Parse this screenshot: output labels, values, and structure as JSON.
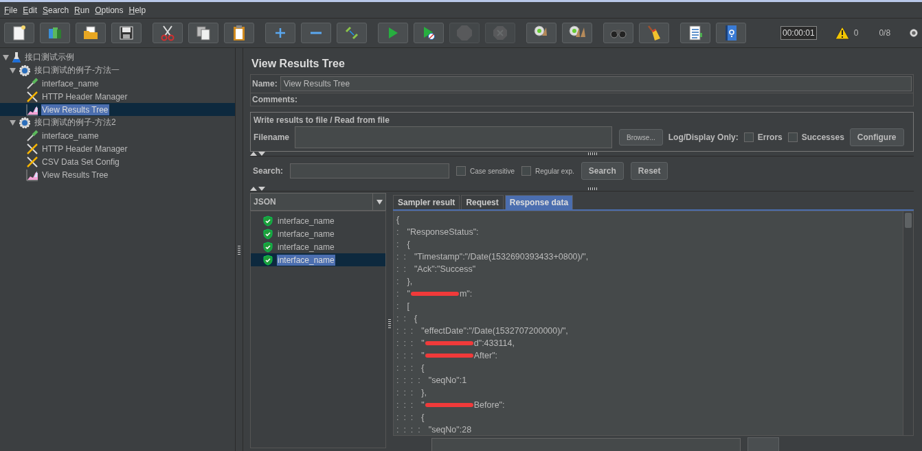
{
  "menu": [
    {
      "label": "File"
    },
    {
      "label": "Edit"
    },
    {
      "label": "Search"
    },
    {
      "label": "Run"
    },
    {
      "label": "Options"
    },
    {
      "label": "Help"
    }
  ],
  "toolbar": {
    "groups": [
      {
        "buttons": [
          {
            "kind": "new",
            "disabled": false
          },
          {
            "kind": "templates",
            "disabled": false
          },
          {
            "kind": "open",
            "disabled": false
          },
          {
            "kind": "save",
            "disabled": false
          }
        ]
      },
      {
        "buttons": [
          {
            "kind": "cut",
            "disabled": false
          },
          {
            "kind": "copy",
            "disabled": false
          },
          {
            "kind": "paste",
            "disabled": false
          }
        ]
      },
      {
        "buttons": [
          {
            "kind": "add",
            "disabled": false
          },
          {
            "kind": "remove",
            "disabled": false
          },
          {
            "kind": "toggle",
            "disabled": false
          }
        ]
      },
      {
        "buttons": [
          {
            "kind": "start",
            "disabled": false
          },
          {
            "kind": "start_no_timers",
            "disabled": false
          },
          {
            "kind": "stop",
            "disabled": true
          },
          {
            "kind": "shutdown",
            "disabled": true
          }
        ]
      },
      {
        "buttons": [
          {
            "kind": "clear",
            "disabled": false
          },
          {
            "kind": "clear_all",
            "disabled": false
          }
        ]
      },
      {
        "buttons": [
          {
            "kind": "search",
            "disabled": false
          },
          {
            "kind": "reset",
            "disabled": false
          }
        ]
      },
      {
        "buttons": [
          {
            "kind": "function_helper",
            "disabled": false
          },
          {
            "kind": "help",
            "disabled": false
          }
        ]
      }
    ],
    "timer": "00:00:01",
    "warnings": "0",
    "threads": "0/8"
  },
  "tree": [
    {
      "label": "接口测试示例",
      "kind": "testplan",
      "expanded": true,
      "selected": false,
      "children": [
        {
          "label": "接口测试的例子-方法一",
          "kind": "threadgroup",
          "expanded": true,
          "selected": false,
          "children": [
            {
              "label": "interface_name",
              "kind": "sampler",
              "selected": false
            },
            {
              "label": "HTTP Header Manager",
              "kind": "config",
              "selected": false
            },
            {
              "label": "View Results Tree",
              "kind": "listener",
              "selected": true
            }
          ]
        },
        {
          "label": "接口测试的例子-方法2",
          "kind": "threadgroup",
          "expanded": true,
          "selected": false,
          "children": [
            {
              "label": "interface_name",
              "kind": "sampler",
              "selected": false
            },
            {
              "label": "HTTP Header Manager",
              "kind": "config",
              "selected": false
            },
            {
              "label": "CSV Data Set Config",
              "kind": "config",
              "selected": false
            },
            {
              "label": "View Results Tree",
              "kind": "listener",
              "selected": false
            }
          ]
        }
      ]
    }
  ],
  "panel": {
    "title": "View Results Tree",
    "name_label": "Name:",
    "name_value": "View Results Tree",
    "comments_label": "Comments:",
    "file_group": {
      "legend": "Write results to file / Read from file",
      "filename_label": "Filename",
      "browse": "Browse...",
      "log_label": "Log/Display Only:",
      "errors": {
        "label": "Errors",
        "checked": false
      },
      "successes": {
        "label": "Successes",
        "checked": false
      },
      "configure": "Configure"
    },
    "search": {
      "label": "Search:",
      "case_sensitive": {
        "label": "Case sensitive",
        "checked": false
      },
      "regex": {
        "label": "Regular exp.",
        "checked": false
      },
      "search_button": "Search",
      "reset_button": "Reset"
    },
    "renderer": "JSON",
    "results": [
      {
        "label": "interface_name",
        "selected": false
      },
      {
        "label": "interface_name",
        "selected": false
      },
      {
        "label": "interface_name",
        "selected": false
      },
      {
        "label": "interface_name",
        "selected": true
      }
    ],
    "tabs": [
      {
        "label": "Sampler result",
        "selected": false
      },
      {
        "label": "Request",
        "selected": false
      },
      {
        "label": "Response data",
        "selected": true
      }
    ],
    "response_lines": [
      {
        "text": "{",
        "redacted": false
      },
      {
        "guides": ":",
        "text": "\"ResponseStatus\":",
        "redacted": false
      },
      {
        "guides": ":",
        "text": "{",
        "redacted": false
      },
      {
        "guides": ":  :",
        "text": "\"Timestamp\":\"/Date(1532690393433+0800)/\",",
        "redacted": false
      },
      {
        "guides": ":  :",
        "text": "\"Ack\":\"Success\"",
        "redacted": false
      },
      {
        "guides": ":",
        "text": "},",
        "redacted": false
      },
      {
        "guides": ":",
        "prefix": "\"",
        "text": "m\":",
        "redacted": true
      },
      {
        "guides": ":",
        "text": "[",
        "redacted": false
      },
      {
        "guides": ":  :",
        "text": "{",
        "redacted": false
      },
      {
        "guides": ":  :  :",
        "text": "\"effectDate\":\"/Date(1532707200000)/\",",
        "redacted": false
      },
      {
        "guides": ":  :  :",
        "prefix": "\"",
        "text": "d\":433114,",
        "redacted": true
      },
      {
        "guides": ":  :  :",
        "prefix": "\"",
        "text": "After\":",
        "redacted": true
      },
      {
        "guides": ":  :  :",
        "text": "{",
        "redacted": false
      },
      {
        "guides": ":  :  :  :",
        "text": "\"seqNo\":1",
        "redacted": false
      },
      {
        "guides": ":  :  :",
        "text": "},",
        "redacted": false
      },
      {
        "guides": ":  :  :",
        "prefix": "\"",
        "text": "Before\":",
        "redacted": true
      },
      {
        "guides": ":  :  :",
        "text": "{",
        "redacted": false
      },
      {
        "guides": ":  :  :  :",
        "text": "\"seqNo\":28",
        "redacted": false
      }
    ]
  }
}
